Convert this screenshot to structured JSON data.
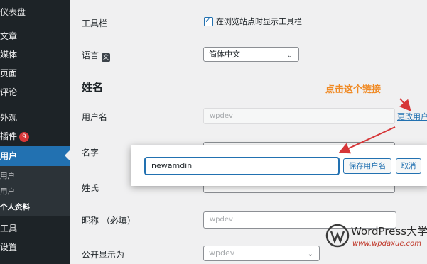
{
  "sidebar": {
    "items": [
      {
        "label": "仪表盘"
      },
      {
        "label": "文章"
      },
      {
        "label": "媒体"
      },
      {
        "label": "页面"
      },
      {
        "label": "评论"
      },
      {
        "label": "外观"
      },
      {
        "label": "插件",
        "badge": "9"
      },
      {
        "label": "用户"
      },
      {
        "label": "工具"
      },
      {
        "label": "设置"
      }
    ],
    "submenu": [
      "用户",
      "用户",
      "个人资料"
    ]
  },
  "profile": {
    "toolbar_label": "工具栏",
    "toolbar_checkbox_label": "在浏览站点时显示工具栏",
    "toolbar_checked": true,
    "language_label": "语言",
    "language_value": "简体中文",
    "name_section": "姓名",
    "username_label": "用户名",
    "username_value": "wpdev",
    "change_username_link": "更改用户",
    "first_name_label": "名字",
    "last_name_label": "姓氏",
    "nickname_label": "昵称 （必填）",
    "nickname_value": "wpdev",
    "display_name_label": "公开显示为",
    "display_name_value": "wpdev"
  },
  "annotation": {
    "text": "点击这个链接",
    "color": "#f08a24"
  },
  "popup": {
    "input_value": "newamdin",
    "save_label": "保存用户名",
    "cancel_label": "取消"
  },
  "watermark": {
    "title": "WordPress大学",
    "url": "www.wpdaxue.com"
  },
  "colors": {
    "sidebar": "#1d2327",
    "accent": "#2271b1",
    "arrow": "#d63638"
  }
}
